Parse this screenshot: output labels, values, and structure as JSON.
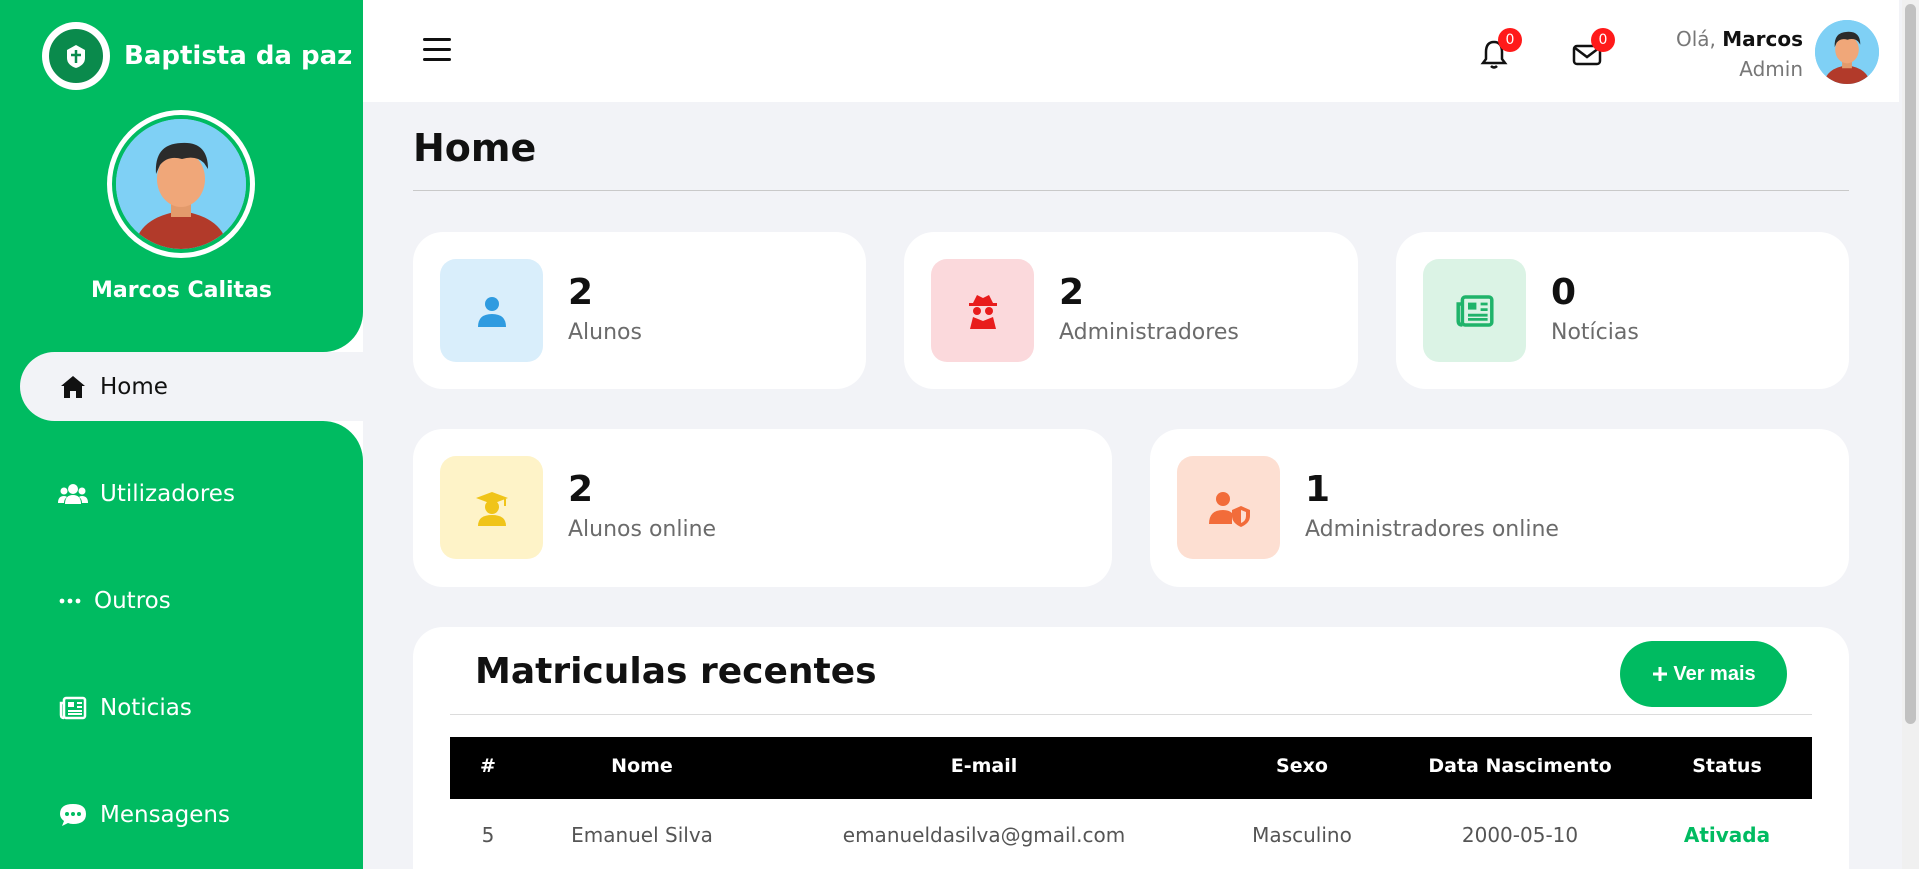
{
  "sidebar": {
    "brand": "Baptista da paz",
    "user_name": "Marcos Calitas",
    "items": [
      {
        "label": "Home",
        "icon": "home-icon"
      },
      {
        "label": "Utilizadores",
        "icon": "users-icon"
      },
      {
        "label": "Outros",
        "icon": "ellipsis-icon"
      },
      {
        "label": "Noticias",
        "icon": "newspaper-icon"
      },
      {
        "label": "Mensagens",
        "icon": "chat-icon"
      }
    ]
  },
  "header": {
    "notifications_count": "0",
    "messages_count": "0",
    "greeting_prefix": "Olá,",
    "user_first_name": "Marcos",
    "role": "Admin"
  },
  "page": {
    "title": "Home"
  },
  "stats": [
    {
      "value": "2",
      "label": "Alunos",
      "icon": "student-icon",
      "color": "#2f9be0",
      "bg": "#d9eefb"
    },
    {
      "value": "2",
      "label": "Administradores",
      "icon": "spy-icon",
      "color": "#e81c1c",
      "bg": "#fbd9dc"
    },
    {
      "value": "0",
      "label": "Notícias",
      "icon": "newspaper-icon",
      "color": "#1fb36a",
      "bg": "#dbf3e5"
    },
    {
      "value": "2",
      "label": "Alunos online",
      "icon": "graduate-icon",
      "color": "#f0c419",
      "bg": "#fef3c8"
    },
    {
      "value": "1",
      "label": "Administradores online",
      "icon": "user-shield-icon",
      "color": "#f26c3a",
      "bg": "#fddfd2"
    }
  ],
  "recent": {
    "title": "Matriculas recentes",
    "button_label": "Ver mais",
    "columns": [
      "#",
      "Nome",
      "E-mail",
      "Sexo",
      "Data Nascimento",
      "Status"
    ],
    "rows": [
      {
        "id": "5",
        "nome": "Emanuel Silva",
        "email": "emanueldasilva@gmail.com",
        "sexo": "Masculino",
        "nascimento": "2000-05-10",
        "status": "Ativada"
      }
    ]
  },
  "colors": {
    "accent": "#00bb61",
    "badge": "#ff1a1a"
  }
}
